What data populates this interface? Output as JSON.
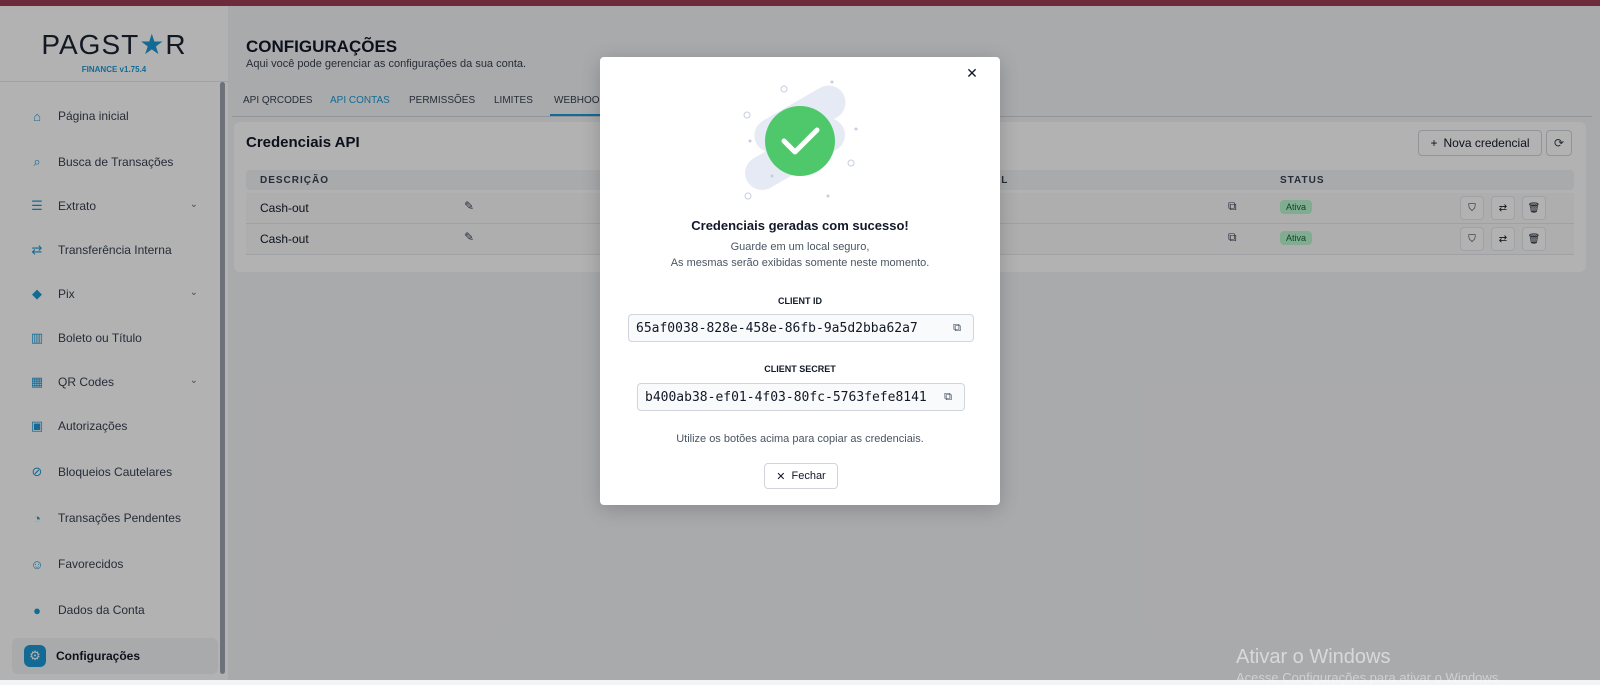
{
  "app": {
    "logo_left": "PAGST",
    "logo_star": "★",
    "logo_right": "R",
    "version": "FINANCE v1.75.4"
  },
  "sidebar": {
    "items": [
      {
        "label": "Página inicial",
        "icon": "home-icon",
        "glyph": "⌂"
      },
      {
        "label": "Busca de Transações",
        "icon": "search-icon",
        "glyph": "⌕"
      },
      {
        "label": "Extrato",
        "icon": "list-icon",
        "glyph": "☰",
        "expandable": true
      },
      {
        "label": "Transferência Interna",
        "icon": "transfer-icon",
        "glyph": "⇄"
      },
      {
        "label": "Pix",
        "icon": "pix-icon",
        "glyph": "◆",
        "expandable": true
      },
      {
        "label": "Boleto ou Título",
        "icon": "barcode-icon",
        "glyph": "▥"
      },
      {
        "label": "QR Codes",
        "icon": "qrcode-icon",
        "glyph": "▦",
        "expandable": true
      },
      {
        "label": "Autorizações",
        "icon": "clipboard-icon",
        "glyph": "▣"
      },
      {
        "label": "Bloqueios Cautelares",
        "icon": "block-icon",
        "glyph": "⊘"
      },
      {
        "label": "Transações Pendentes",
        "icon": "clock-icon",
        "glyph": "◔"
      },
      {
        "label": "Favorecidos",
        "icon": "user-check-icon",
        "glyph": "☺"
      },
      {
        "label": "Dados da Conta",
        "icon": "user-icon",
        "glyph": "●"
      },
      {
        "label": "Configurações",
        "icon": "gear-icon",
        "glyph": "⚙",
        "active": true
      }
    ]
  },
  "header": {
    "title": "CONFIGURAÇÕES",
    "subtitle": "Aqui você pode gerenciar as configurações da sua conta."
  },
  "tabs": [
    {
      "label": "API QRCODES"
    },
    {
      "label": "API CONTAS",
      "active": true
    },
    {
      "label": "PERMISSÕES"
    },
    {
      "label": "LIMITES"
    },
    {
      "label": "WEBHOOK"
    }
  ],
  "credentials": {
    "title": "Credenciais API",
    "new_button": "Nova credencial",
    "columns": {
      "description": "DESCRIÇÃO",
      "credential": "CIAL",
      "status": "STATUS"
    },
    "rows": [
      {
        "description": "Cash-out",
        "status": "Ativa"
      },
      {
        "description": "Cash-out",
        "status": "Ativa"
      }
    ]
  },
  "modal": {
    "title": "Credenciais geradas com sucesso!",
    "subtitle_line1": "Guarde em um local seguro,",
    "subtitle_line2": "As mesmas serão exibidas somente neste momento.",
    "client_id_label": "CLIENT ID",
    "client_id": "65af0038-828e-458e-86fb-9a5d2bba62a7",
    "client_secret_label": "CLIENT SECRET",
    "client_secret": "b400ab38-ef01-4f03-80fc-5763fefe8141",
    "hint": "Utilize os botões acima para copiar as credenciais.",
    "close_button": "Fechar"
  },
  "watermark": {
    "line1": "Ativar o Windows",
    "line2": "Acesse Configurações para ativar o Windows."
  },
  "colors": {
    "accent": "#1c9ad6",
    "success": "#4ec86b",
    "topbar": "#9d3f55"
  }
}
